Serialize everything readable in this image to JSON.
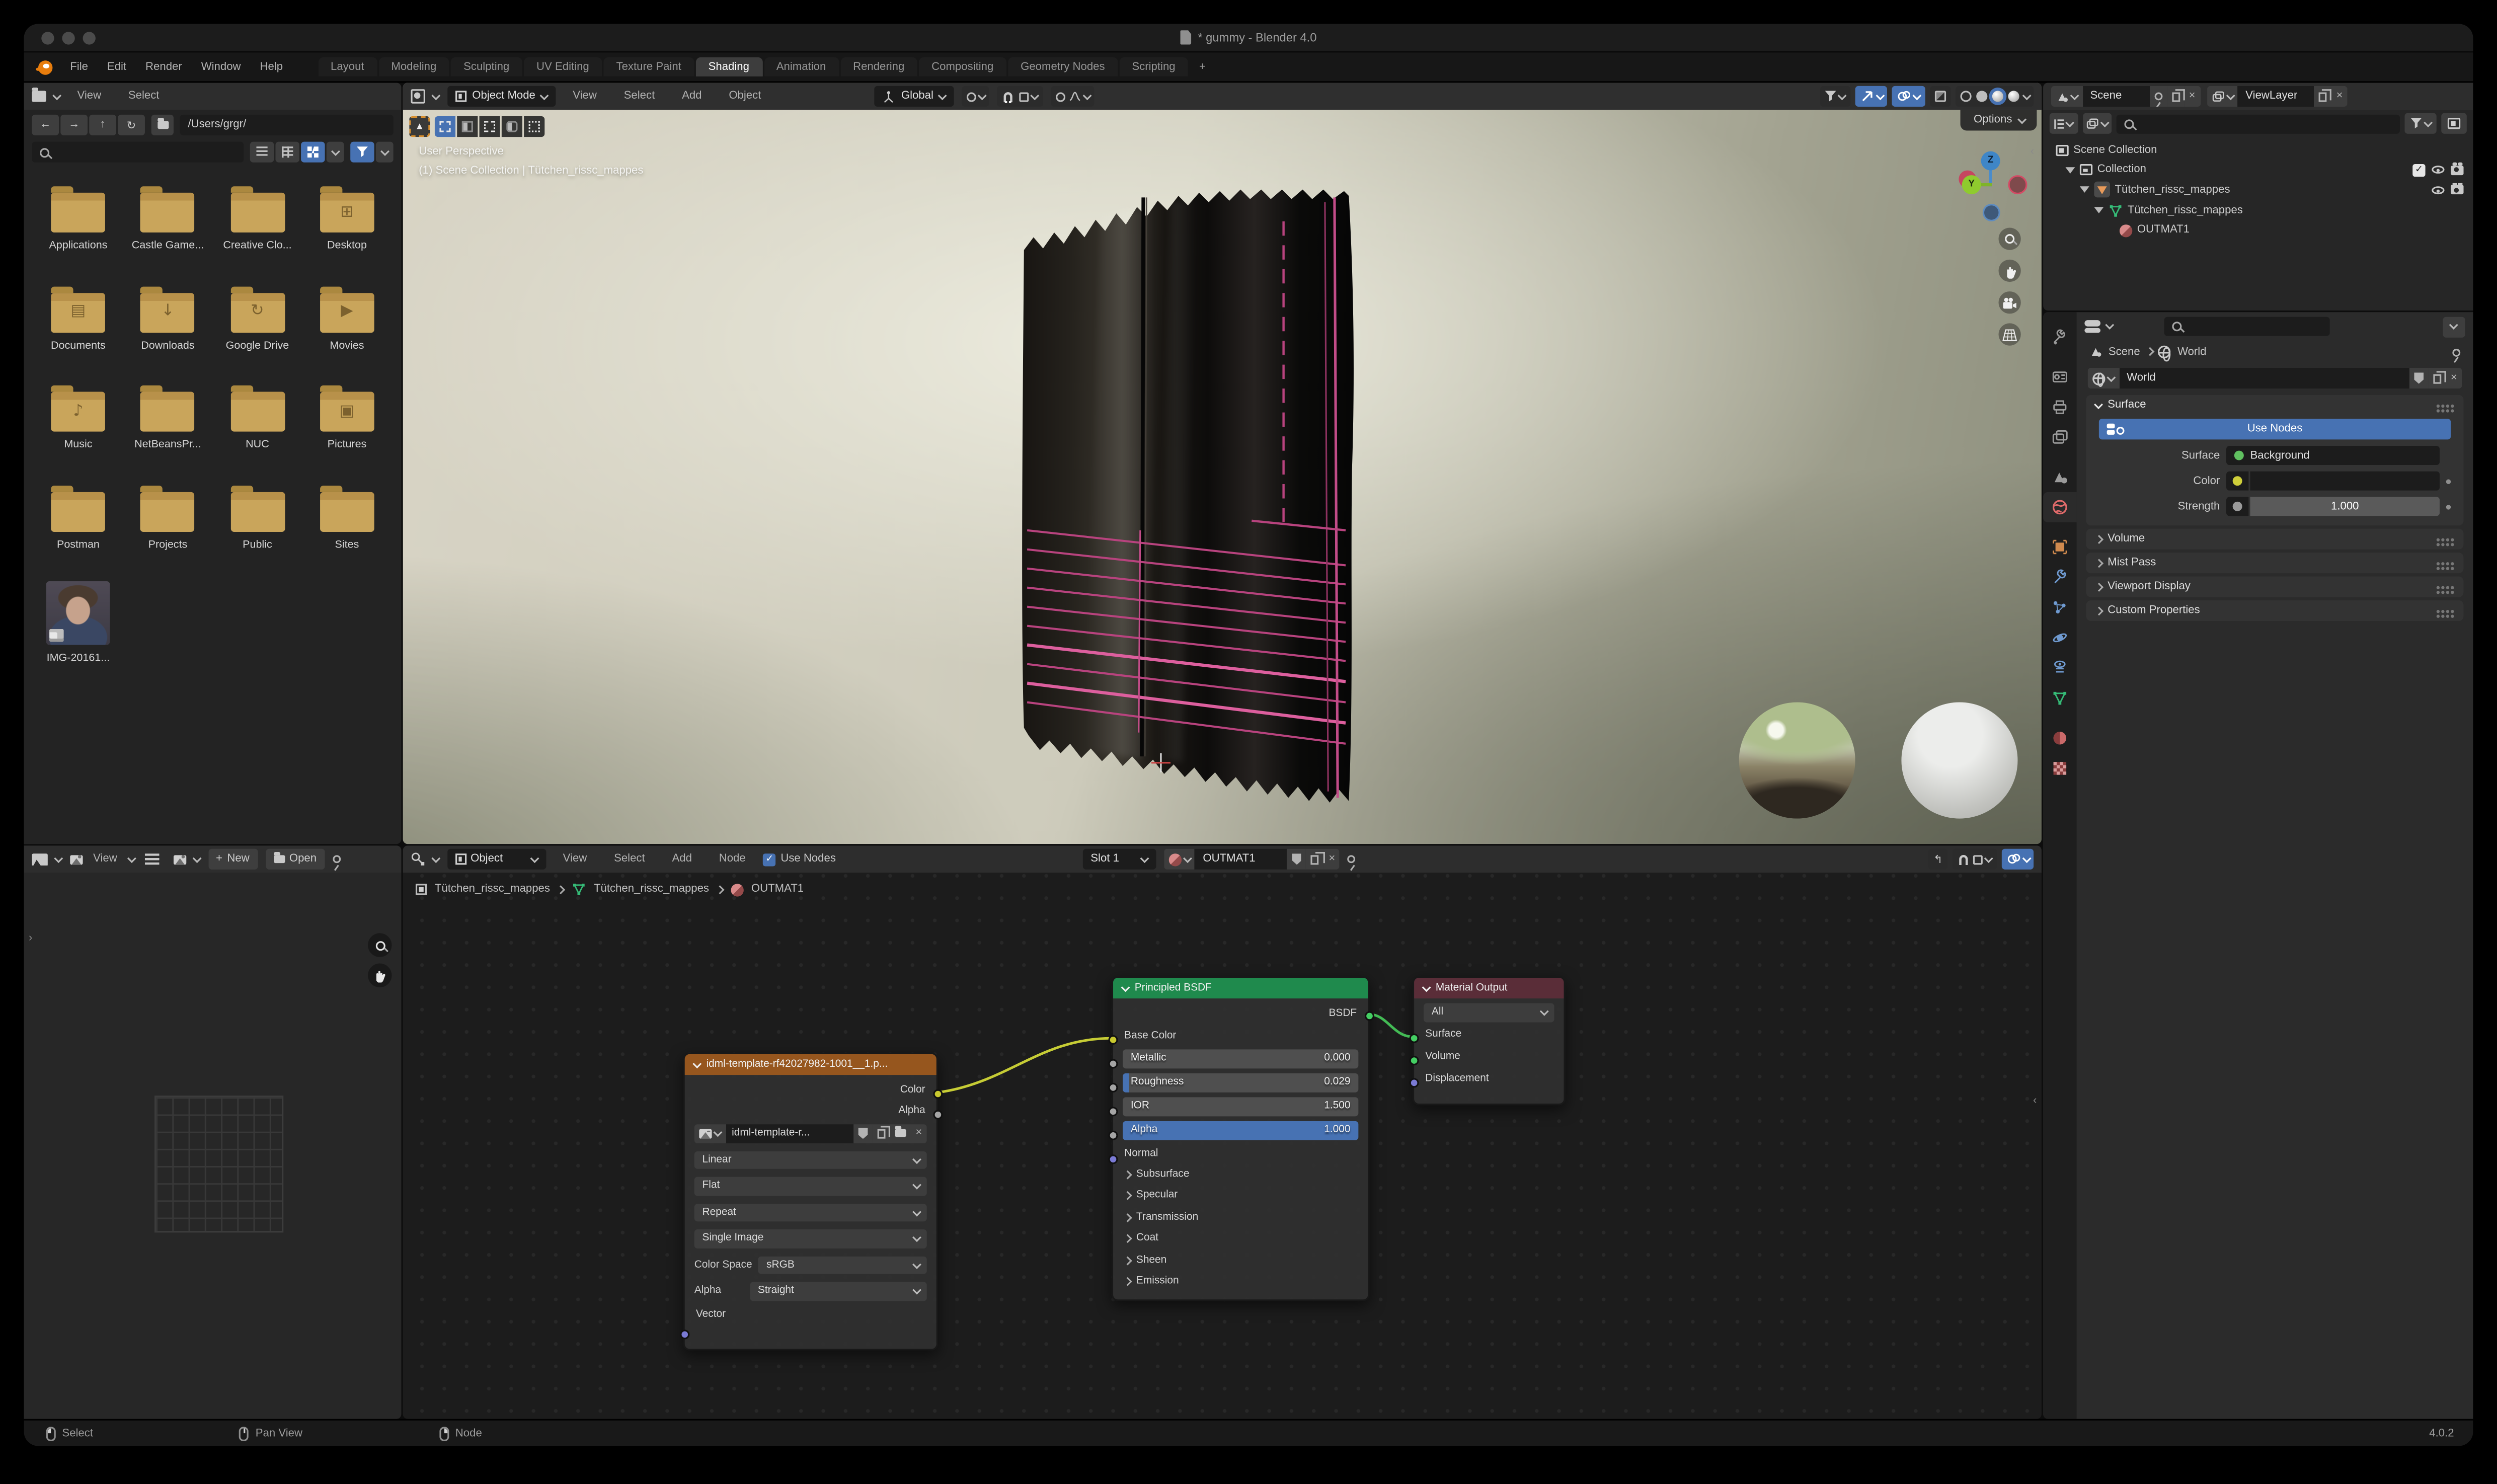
{
  "window": {
    "title": "* gummy - Blender 4.0"
  },
  "menubar": {
    "menus": [
      {
        "label": "File"
      },
      {
        "label": "Edit"
      },
      {
        "label": "Render"
      },
      {
        "label": "Window"
      },
      {
        "label": "Help"
      }
    ],
    "workspaces": [
      {
        "label": "Layout"
      },
      {
        "label": "Modeling"
      },
      {
        "label": "Sculpting"
      },
      {
        "label": "UV Editing"
      },
      {
        "label": "Texture Paint"
      },
      {
        "label": "Shading"
      },
      {
        "label": "Animation"
      },
      {
        "label": "Rendering"
      },
      {
        "label": "Compositing"
      },
      {
        "label": "Geometry Nodes"
      },
      {
        "label": "Scripting"
      }
    ],
    "active_workspace": "Shading",
    "add_workspace": "+"
  },
  "file_browser": {
    "menus": {
      "view": "View",
      "select": "Select"
    },
    "path": "/Users/grgr/",
    "items": [
      {
        "label": "Applications"
      },
      {
        "label": "Castle Game..."
      },
      {
        "label": "Creative Clo..."
      },
      {
        "label": "Desktop"
      },
      {
        "label": "Documents"
      },
      {
        "label": "Downloads"
      },
      {
        "label": "Google Drive"
      },
      {
        "label": "Movies"
      },
      {
        "label": "Music"
      },
      {
        "label": "NetBeansPr..."
      },
      {
        "label": "NUC"
      },
      {
        "label": "Pictures"
      },
      {
        "label": "Postman"
      },
      {
        "label": "Projects"
      },
      {
        "label": "Public"
      },
      {
        "label": "Sites"
      },
      {
        "label": "IMG-20161..."
      }
    ]
  },
  "viewport": {
    "header": {
      "mode": "Object Mode",
      "menus": [
        "View",
        "Select",
        "Add",
        "Object"
      ],
      "orientation": "Global"
    },
    "options_label": "Options",
    "overlay": {
      "line1": "User Perspective",
      "line2": "(1) Scene Collection | Tütchen_rissc_mappes"
    },
    "gizmo": {
      "z": "Z",
      "y": "Y"
    }
  },
  "outliner": {
    "scene": "Scene",
    "view_layer": "ViewLayer",
    "tree": [
      {
        "label": "Scene Collection"
      },
      {
        "label": "Collection"
      },
      {
        "label": "Tütchen_rissc_mappes"
      },
      {
        "label": "Tütchen_rissc_mappes"
      },
      {
        "label": "OUTMAT1"
      }
    ]
  },
  "properties": {
    "breadcrumb": {
      "scene": "Scene",
      "world": "World"
    },
    "datablock": "World",
    "surface_panel": {
      "title": "Surface",
      "use_nodes": "Use Nodes",
      "surface_label": "Surface",
      "surface_value": "Background",
      "color_label": "Color",
      "strength_label": "Strength",
      "strength_value": "1.000"
    },
    "collapsed_panels": [
      {
        "title": "Volume"
      },
      {
        "title": "Mist Pass"
      },
      {
        "title": "Viewport Display"
      },
      {
        "title": "Custom Properties"
      }
    ]
  },
  "image_editor": {
    "view_menu": "View",
    "new_button": "New",
    "open_button": "Open"
  },
  "shader_editor": {
    "header": {
      "type_label": "Object",
      "menus": [
        "View",
        "Select",
        "Add",
        "Node"
      ],
      "use_nodes": "Use Nodes",
      "slot": "Slot 1",
      "material": "OUTMAT1"
    },
    "breadcrumb": [
      "Tütchen_rissc_mappes",
      "Tütchen_rissc_mappes",
      "OUTMAT1"
    ],
    "nodes": {
      "image_texture": {
        "title": "idml-template-rf42027982-1001__1.p...",
        "outputs": [
          "Color",
          "Alpha"
        ],
        "image_name": "idml-template-r...",
        "interpolation": "Linear",
        "projection": "Flat",
        "extension": "Repeat",
        "source": "Single Image",
        "color_space_label": "Color Space",
        "color_space": "sRGB",
        "alpha_label": "Alpha",
        "alpha_mode": "Straight",
        "input": "Vector"
      },
      "principled": {
        "title": "Principled BSDF",
        "output": "BSDF",
        "base_color": "Base Color",
        "rows": [
          {
            "label": "Metallic",
            "value": "0.000"
          },
          {
            "label": "Roughness",
            "value": "0.029"
          },
          {
            "label": "IOR",
            "value": "1.500"
          },
          {
            "label": "Alpha",
            "value": "1.000"
          }
        ],
        "normal": "Normal",
        "sections": [
          "Subsurface",
          "Specular",
          "Transmission",
          "Coat",
          "Sheen",
          "Emission"
        ]
      },
      "material_output": {
        "title": "Material Output",
        "target": "All",
        "inputs": [
          "Surface",
          "Volume",
          "Displacement"
        ]
      }
    }
  },
  "status_bar": {
    "items": [
      {
        "label": "Select"
      },
      {
        "label": "Pan View"
      },
      {
        "label": "Node"
      }
    ],
    "version": "4.0.2"
  },
  "colors": {
    "accent": "#4772b3",
    "folder": "#c9a55b",
    "node_image_header": "#96561e",
    "node_bsdf_header": "#1f8a4d",
    "node_output_header": "#5a2d38",
    "socket_yellow": "#c9c92f",
    "socket_green": "#44cf63",
    "socket_grey": "#a5a5a5",
    "socket_purple": "#7a7ad4"
  }
}
